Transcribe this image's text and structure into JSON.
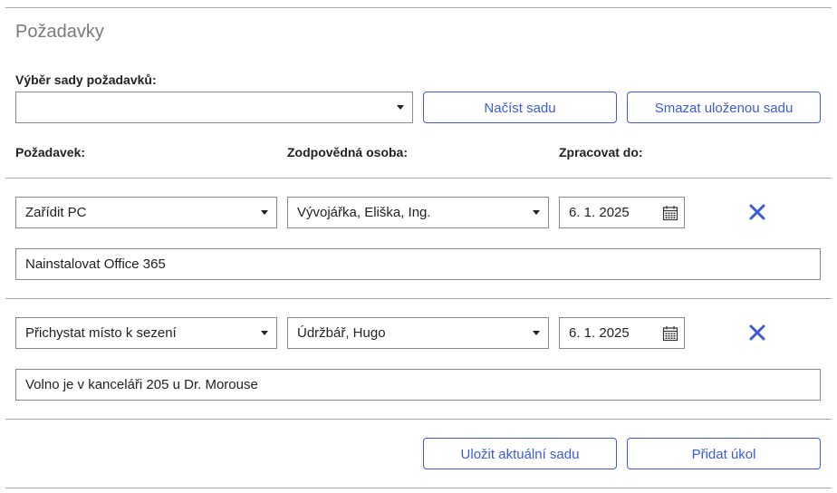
{
  "section_title": "Požadavky",
  "set_selector": {
    "label": "Výběr sady požadavků:",
    "value": "",
    "load_button": "Načíst sadu",
    "delete_button": "Smazat uloženou sadu"
  },
  "columns": {
    "request": "Požadavek:",
    "responsible": "Zodpovědná osoba:",
    "due": "Zpracovat do:"
  },
  "rows": [
    {
      "request": "Zařídit PC",
      "responsible": "Vývojářka, Eliška, Ing.",
      "due": "6. 1. 2025",
      "note": "Nainstalovat Office 365"
    },
    {
      "request": "Přichystat místo k sezení",
      "responsible": "Údržbář, Hugo",
      "due": "6. 1. 2025",
      "note": "Volno je v kanceláři 205 u Dr. Morouse"
    }
  ],
  "footer": {
    "save_button": "Uložit aktuální sadu",
    "add_button": "Přidat úkol"
  },
  "colors": {
    "accent": "#3b5bdb",
    "border": "#8a8a8a",
    "divider": "#a8a8a8"
  }
}
